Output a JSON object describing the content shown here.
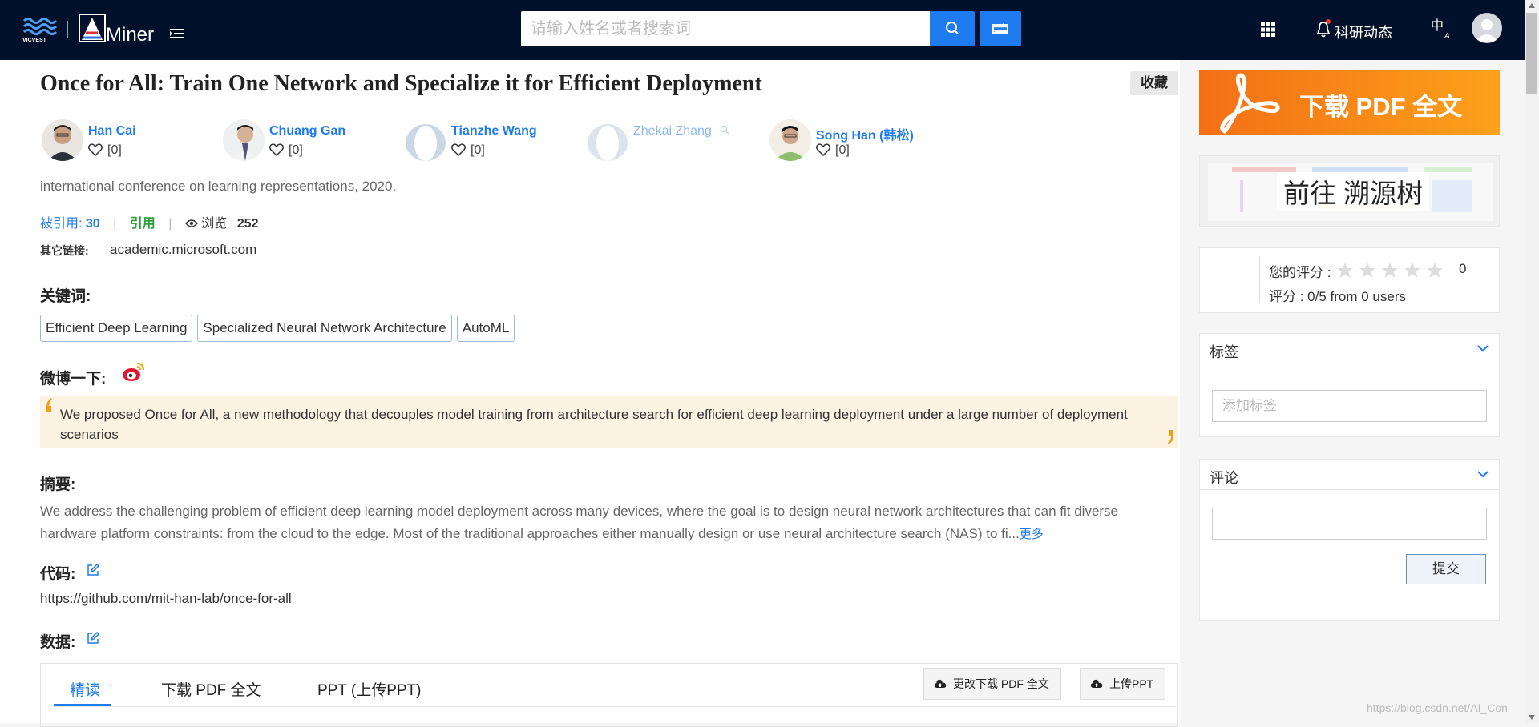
{
  "header": {
    "brand_left": "VICVEST",
    "brand": "Miner",
    "search_placeholder": "请输入姓名或者搜索词",
    "news_label": "科研动态",
    "lang_label": "中",
    "lang_sub": "A"
  },
  "paper": {
    "title": "Once for All: Train One Network and Specialize it for Efficient Deployment",
    "favorite_label": "收藏",
    "authors": [
      {
        "name": "Han Cai",
        "likes": "[0]"
      },
      {
        "name": "Chuang Gan",
        "likes": "[0]"
      },
      {
        "name": "Tianzhe Wang",
        "likes": "[0]"
      },
      {
        "name": "Zhekai Zhang"
      },
      {
        "name": "Song Han (韩松)",
        "likes": "[0]"
      }
    ],
    "venue": "international conference on learning representations, 2020.",
    "cited_label": "被引用:",
    "cited_count": "30",
    "cite_label": "引用",
    "views_label": "浏览",
    "views_count": "252",
    "other_links_label": "其它链接:",
    "other_link": "academic.microsoft.com",
    "keywords_label": "关键词",
    "keywords": [
      "Efficient Deep Learning",
      "Specialized Neural Network Architecture",
      "AutoML"
    ],
    "weibo_label": "微博一下",
    "weibo_quote": "We proposed Once for All, a new methodology that decouples model training from architecture search for efficient deep learning deployment under a large number of deployment scenarios",
    "abstract_label": "摘要",
    "abstract": "We address the challenging problem of efficient deep learning model deployment across many devices, where the goal is to design neural network architectures that can fit diverse hardware platform constraints: from the cloud to the edge. Most of the traditional approaches either manually design or use neural architecture search (NAS) to fi...",
    "more_label": "更多",
    "code_label": "代码",
    "code_url": "https://github.com/mit-han-lab/once-for-all",
    "data_label": "数据",
    "colon": ":"
  },
  "tabs": [
    {
      "label": "精读",
      "active": true
    },
    {
      "label": "下载 PDF 全文",
      "active": false
    },
    {
      "label": "PPT (上传PPT)",
      "active": false
    }
  ],
  "actions": {
    "change_pdf": "更改下载 PDF 全文",
    "upload_ppt": "上传PPT"
  },
  "sidebar": {
    "pdf_banner": "下载 PDF 全文",
    "tree_banner": "前往 溯源树",
    "your_rating_label": "您的评分 :",
    "your_rating_count": "0",
    "rating_summary": "评分 : 0/5 from 0 users",
    "stars_filled": 0,
    "stars_total": 5,
    "tags_title": "标签",
    "tag_placeholder": "添加标签",
    "comments_title": "评论",
    "submit_label": "提交"
  },
  "watermark": "https://blog.csdn.net/AI_Con",
  "colors": {
    "header_bg": "#02112b",
    "accent": "#1e7bf0",
    "cite_green": "#2e9e3e",
    "pdf_orange": "#f36f15",
    "quote_bg": "#fdf3e3"
  }
}
